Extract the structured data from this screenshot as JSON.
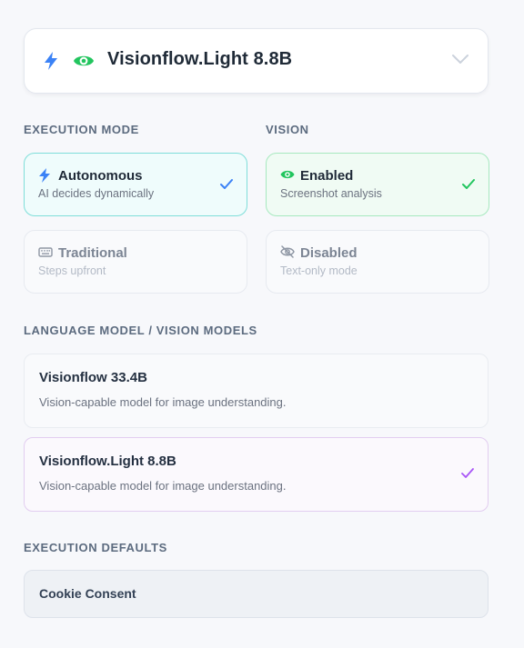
{
  "model_selector": {
    "title": "Visionflow.Light 8.8B",
    "icons": [
      "bolt-icon",
      "eye-icon",
      "chevron-down-icon"
    ]
  },
  "execution_mode": {
    "label": "EXECUTION MODE",
    "options": [
      {
        "name": "Autonomous",
        "desc": "AI decides dynamically",
        "selected": true,
        "icon": "bolt-icon"
      },
      {
        "name": "Traditional",
        "desc": "Steps upfront",
        "selected": false,
        "icon": "keyboard-icon"
      }
    ]
  },
  "vision": {
    "label": "VISION",
    "options": [
      {
        "name": "Enabled",
        "desc": "Screenshot analysis",
        "selected": true,
        "icon": "eye-icon"
      },
      {
        "name": "Disabled",
        "desc": "Text-only mode",
        "selected": false,
        "icon": "eye-off-icon"
      }
    ]
  },
  "models": {
    "label": "LANGUAGE MODEL / VISION MODELS",
    "items": [
      {
        "name": "Visionflow 33.4B",
        "desc": "Vision-capable model for image understanding.",
        "selected": false
      },
      {
        "name": "Visionflow.Light 8.8B",
        "desc": "Vision-capable model for image understanding.",
        "selected": true
      }
    ]
  },
  "defaults": {
    "label": "EXECUTION DEFAULTS",
    "value": "Cookie Consent"
  },
  "colors": {
    "accent_blue": "#3b82f6",
    "accent_green": "#22c55e",
    "accent_purple": "#a855f7",
    "background": "#f7f8fb"
  }
}
